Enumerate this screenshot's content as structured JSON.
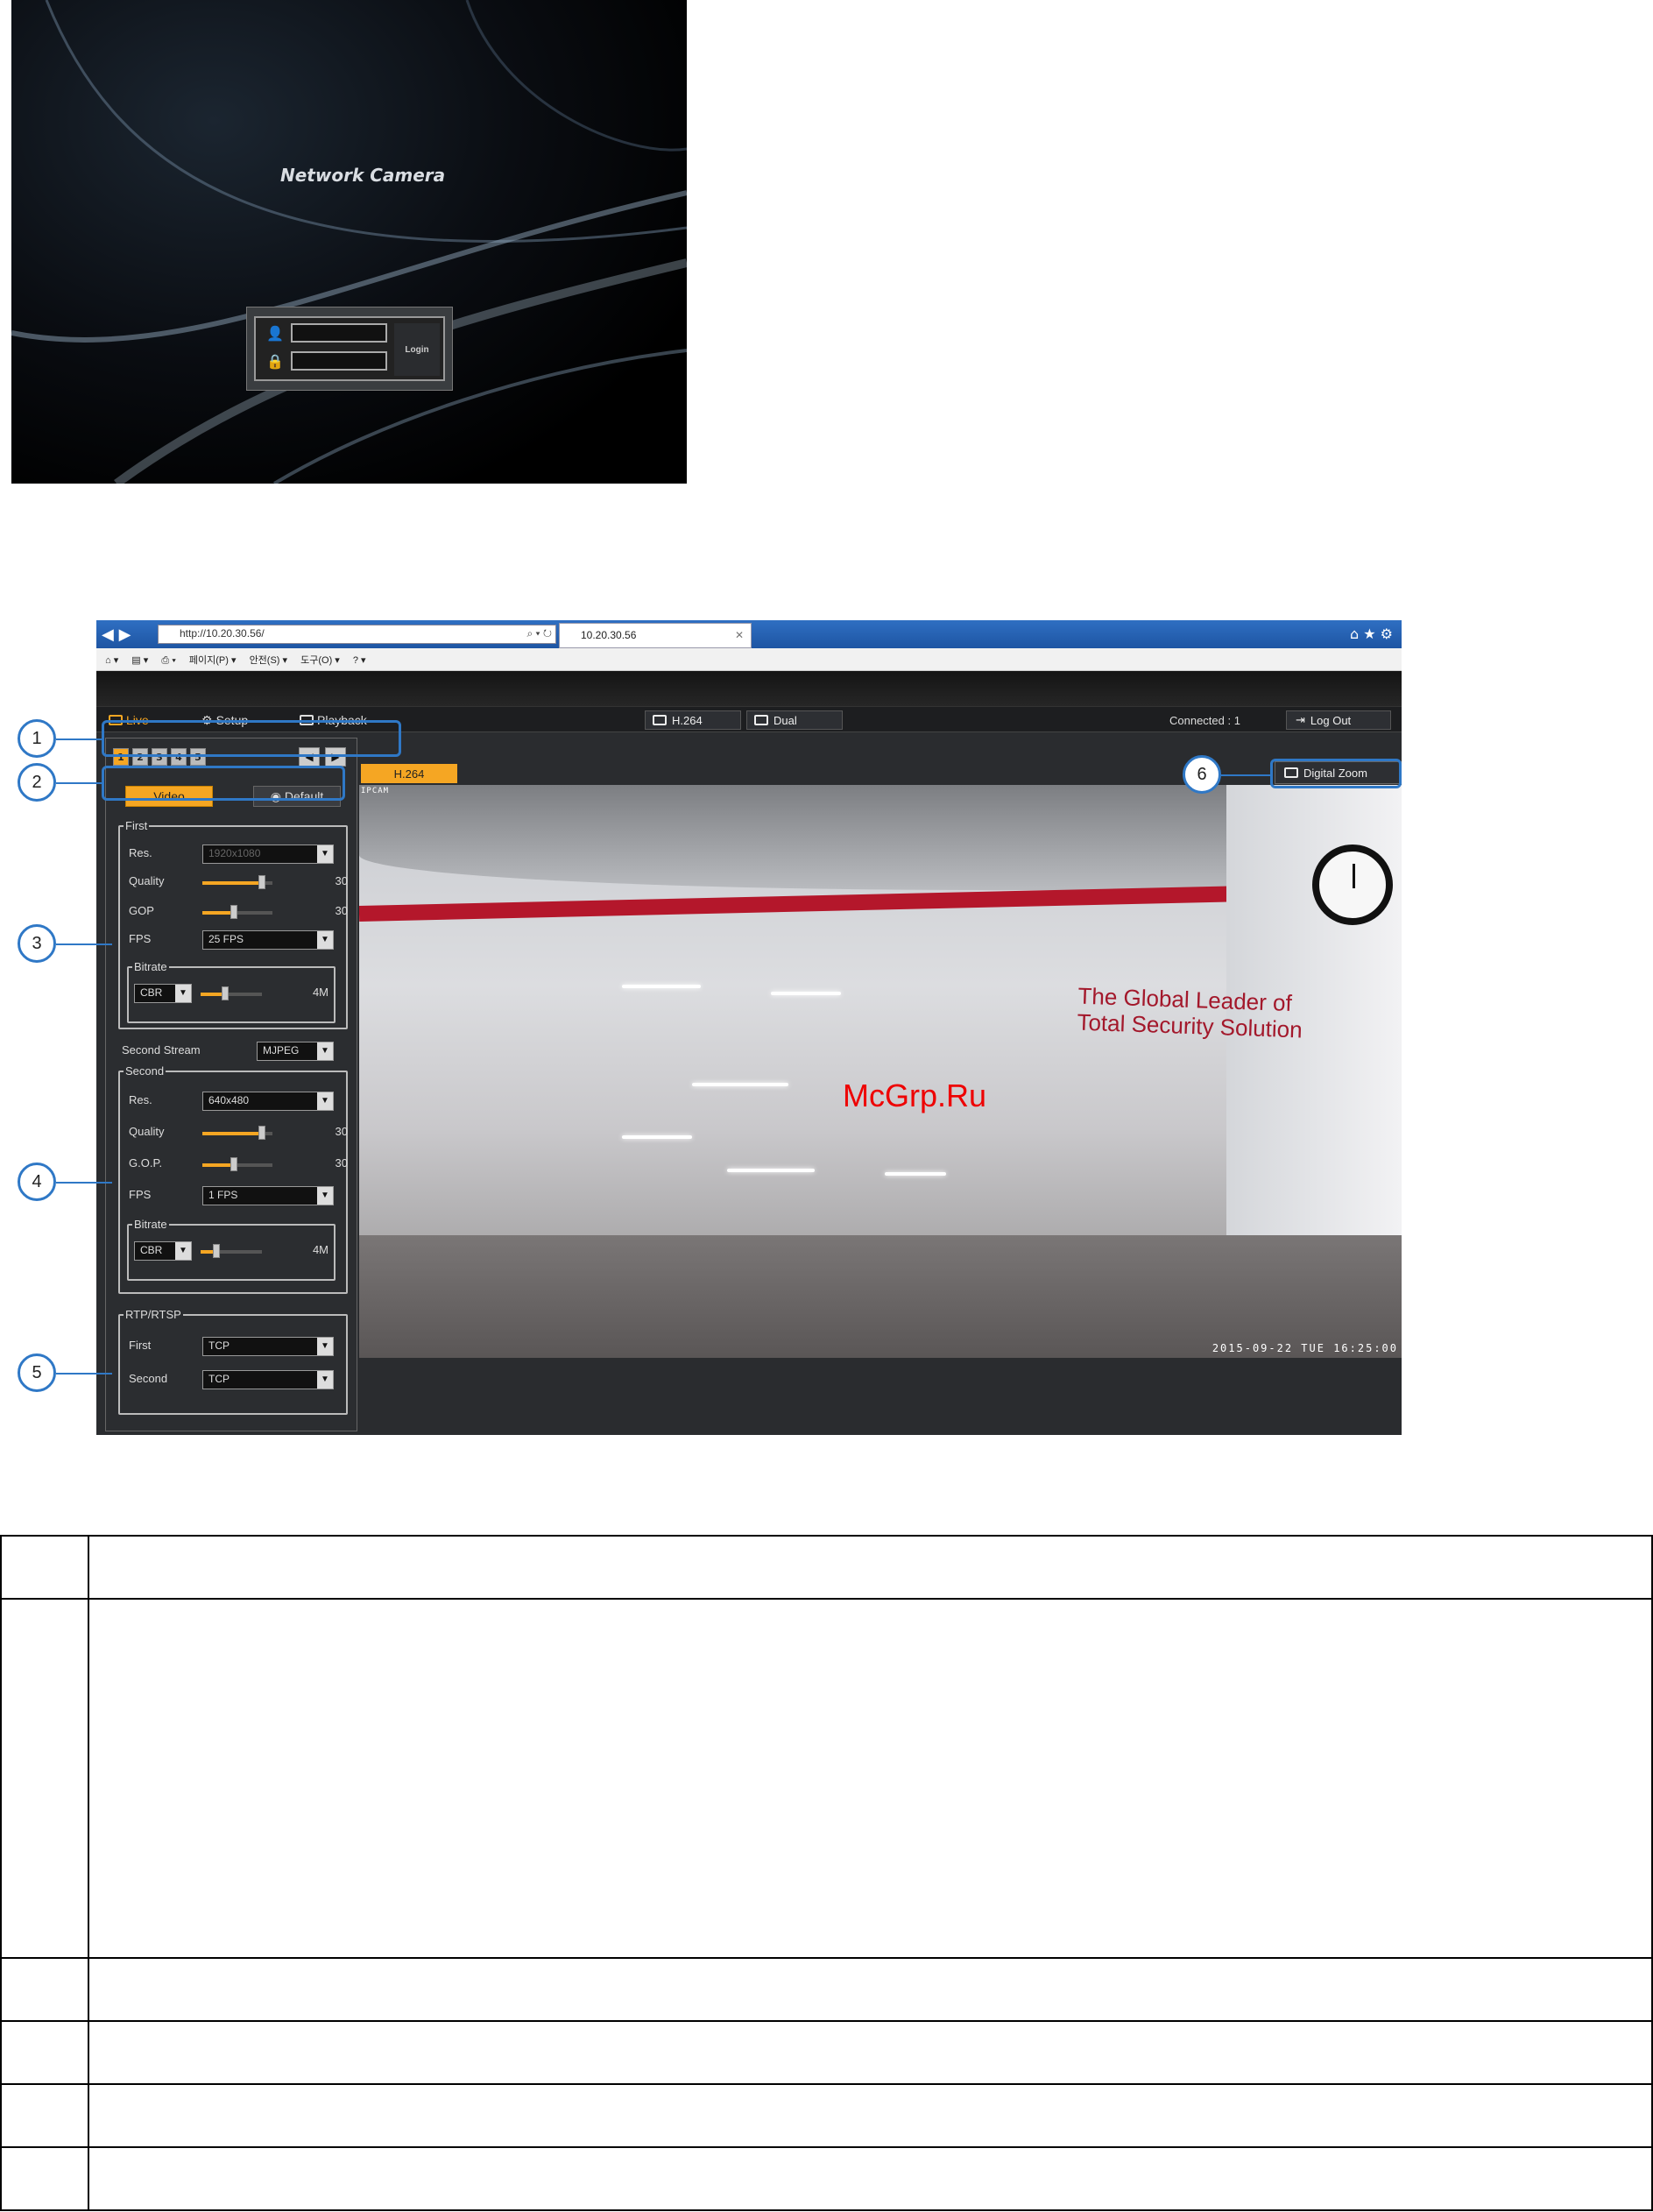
{
  "login": {
    "title": "Network Camera",
    "user_icon": "user-icon",
    "lock_icon": "lock-icon",
    "username_value": "",
    "password_value": "",
    "login_label": "Login"
  },
  "browser": {
    "address": "http://10.20.30.56/",
    "tab_title": "10.20.30.56",
    "commands": [
      "페이지(P) ▾",
      "안전(S) ▾",
      "도구(O) ▾"
    ]
  },
  "app": {
    "nav": {
      "live": "Live",
      "setup": "Setup",
      "playback": "Playback"
    },
    "mode_h264": "H.264",
    "mode_dual": "Dual",
    "connected": "Connected : 1",
    "logout": "Log Out",
    "channels": [
      "1",
      "2",
      "3",
      "4",
      "5"
    ],
    "tab_video": "Video",
    "tab_default": "Default",
    "first": {
      "legend": "First",
      "res_label": "Res.",
      "res_value": "1920x1080",
      "quality_label": "Quality",
      "quality_value": "30",
      "quality_level": 0.85,
      "gop_label": "GOP",
      "gop_value": "30",
      "gop_level": 0.45,
      "fps_label": "FPS",
      "fps_value": "25 FPS",
      "bitrate_legend": "Bitrate",
      "bitrate_mode": "CBR",
      "bitrate_value": "4M",
      "bitrate_level": 0.4
    },
    "second_stream_label": "Second Stream",
    "second_stream_value": "MJPEG",
    "second": {
      "legend": "Second",
      "res_label": "Res.",
      "res_value": "640x480",
      "quality_label": "Quality",
      "quality_value": "30",
      "quality_level": 0.85,
      "gop_label": "G.O.P.",
      "gop_value": "30",
      "gop_level": 0.45,
      "fps_label": "FPS",
      "fps_value": "1 FPS",
      "bitrate_legend": "Bitrate",
      "bitrate_mode": "CBR",
      "bitrate_value": "4M",
      "bitrate_level": 0.25
    },
    "rtp": {
      "legend": "RTP/RTSP",
      "first_label": "First",
      "first_value": "TCP",
      "second_label": "Second",
      "second_value": "TCP"
    },
    "stream_tab": "H.264",
    "digital_zoom": "Digital Zoom",
    "osd_name": "IPCAM",
    "osd_time": "2015-09-22 TUE 16:25:00",
    "scene_text_line1": "The Global Leader of",
    "scene_text_line2": "Total Security Solution",
    "watermark": "McGrp.Ru"
  },
  "callouts": [
    "1",
    "2",
    "3",
    "4",
    "5",
    "6"
  ],
  "colors": {
    "accent": "#f5a623",
    "callout": "#2f78c6"
  }
}
